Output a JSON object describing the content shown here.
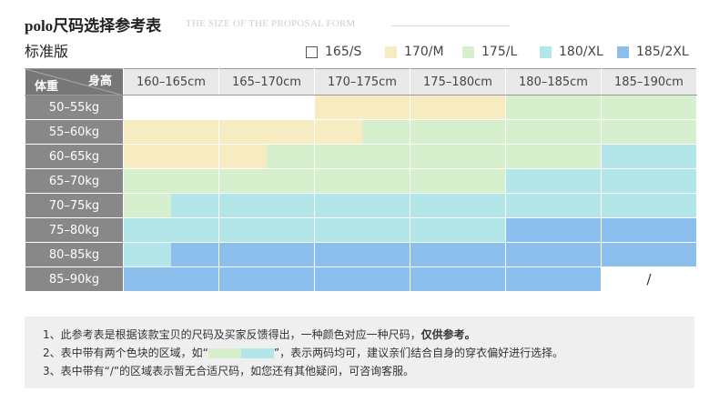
{
  "title": "polo尺码选择参考表",
  "subtitle_en": "THE SIZE OF THE PROPOSAL FORM",
  "version": "标准版",
  "colors": {
    "165/S": "#ffffff",
    "170/M": "#f6ebc1",
    "175/L": "#d6efcc",
    "180/XL": "#b2e6e9",
    "185/2XL": "#8cbfec"
  },
  "legend": [
    {
      "label": "165/S",
      "color": "#ffffff"
    },
    {
      "label": "170/M",
      "color": "#f6ebc1"
    },
    {
      "label": "175/L",
      "color": "#d6efcc"
    },
    {
      "label": "180/XL",
      "color": "#b2e6e9"
    },
    {
      "label": "185/2XL",
      "color": "#8cbfec"
    }
  ],
  "table": {
    "corner_height_label": "身高",
    "corner_weight_label": "体重",
    "height_ranges": [
      "160–165cm",
      "165–170cm",
      "170–175cm",
      "175–180cm",
      "180–185cm",
      "185–190cm"
    ],
    "rows": [
      {
        "weight": "50–55kg",
        "cells": [
          [
            "165/S"
          ],
          [
            "165/S"
          ],
          [
            "170/M"
          ],
          [
            "170/M"
          ],
          [
            "175/L"
          ],
          [
            "175/L"
          ]
        ]
      },
      {
        "weight": "55–60kg",
        "cells": [
          [
            "170/M"
          ],
          [
            "170/M"
          ],
          [
            "170/M",
            "175/L"
          ],
          [
            "175/L"
          ],
          [
            "175/L"
          ],
          [
            "175/L"
          ]
        ]
      },
      {
        "weight": "60–65kg",
        "cells": [
          [
            "170/M"
          ],
          [
            "170/M",
            "175/L"
          ],
          [
            "175/L"
          ],
          [
            "175/L"
          ],
          [
            "175/L"
          ],
          [
            "180/XL"
          ]
        ]
      },
      {
        "weight": "65–70kg",
        "cells": [
          [
            "175/L"
          ],
          [
            "175/L"
          ],
          [
            "175/L"
          ],
          [
            "175/L"
          ],
          [
            "180/XL"
          ],
          [
            "180/XL"
          ]
        ]
      },
      {
        "weight": "70–75kg",
        "cells": [
          [
            "175/L",
            "180/XL"
          ],
          [
            "180/XL"
          ],
          [
            "180/XL"
          ],
          [
            "180/XL"
          ],
          [
            "180/XL"
          ],
          [
            "180/XL"
          ]
        ]
      },
      {
        "weight": "75–80kg",
        "cells": [
          [
            "180/XL"
          ],
          [
            "180/XL"
          ],
          [
            "180/XL"
          ],
          [
            "180/XL"
          ],
          [
            "185/2XL"
          ],
          [
            "185/2XL"
          ]
        ]
      },
      {
        "weight": "80–85kg",
        "cells": [
          [
            "180/XL",
            "185/2XL"
          ],
          [
            "185/2XL"
          ],
          [
            "185/2XL"
          ],
          [
            "185/2XL"
          ],
          [
            "185/2XL"
          ],
          [
            "185/2XL"
          ]
        ]
      },
      {
        "weight": "85–90kg",
        "cells": [
          [
            "185/2XL"
          ],
          [
            "185/2XL"
          ],
          [
            "185/2XL"
          ],
          [
            "185/2XL"
          ],
          [
            "185/2XL"
          ],
          [
            "none"
          ]
        ]
      }
    ],
    "none_mark": "/"
  },
  "notes": {
    "line1_a": "1、此参考表是根据该款宝贝的尺码及买家反馈得出，一种颜色对应一种尺码，",
    "line1_b": "仅供参考。",
    "line2_a": "2、表中带有两个色块的区域，如“",
    "line2_b": "”，表示两码均可，建议亲们结合自身的穿衣偏好进行选择。",
    "line3": "3、表中带有“/”的区域表示暂无合适尺码，如您还有其他疑问，可咨询客服。"
  }
}
